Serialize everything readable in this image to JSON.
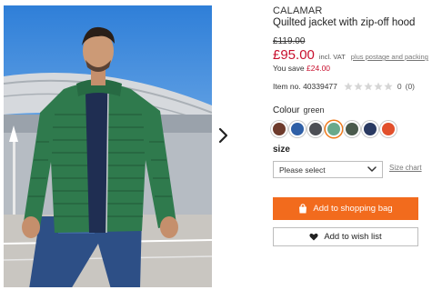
{
  "product": {
    "brand": "CALAMAR",
    "title": "Quilted jacket with zip-off hood",
    "old_price": "£119.00",
    "new_price": "£95.00",
    "vat_note": "incl. VAT",
    "postage_link": "plus postage and packing",
    "savings_prefix": "You save ",
    "savings_amount": "£24.00",
    "item_no": "Item no. 40339477",
    "rating": 0,
    "rating_value": "0",
    "review_count": "(0)"
  },
  "image": {
    "alt": "Man wearing green quilted jacket",
    "next_icon": "chevron-right-icon"
  },
  "colour": {
    "label": "Colour",
    "selected": "green",
    "swatches": [
      {
        "name": "brown",
        "color": "#6e3b2c"
      },
      {
        "name": "blue",
        "color": "#2f5fa6"
      },
      {
        "name": "dark grey",
        "color": "#4d4f55"
      },
      {
        "name": "green",
        "color": "#6aa98b"
      },
      {
        "name": "olive",
        "color": "#4a5a4c"
      },
      {
        "name": "navy",
        "color": "#2a3a62"
      },
      {
        "name": "orange",
        "color": "#e2502c"
      }
    ]
  },
  "size": {
    "label": "size",
    "select_value": "Please select",
    "chart_link": "Size chart"
  },
  "actions": {
    "add_to_bag": "Add to shopping bag",
    "add_to_wishlist": "Add to wish list"
  },
  "colors": {
    "accent": "#f26b1d",
    "price_red": "#c8102e"
  }
}
